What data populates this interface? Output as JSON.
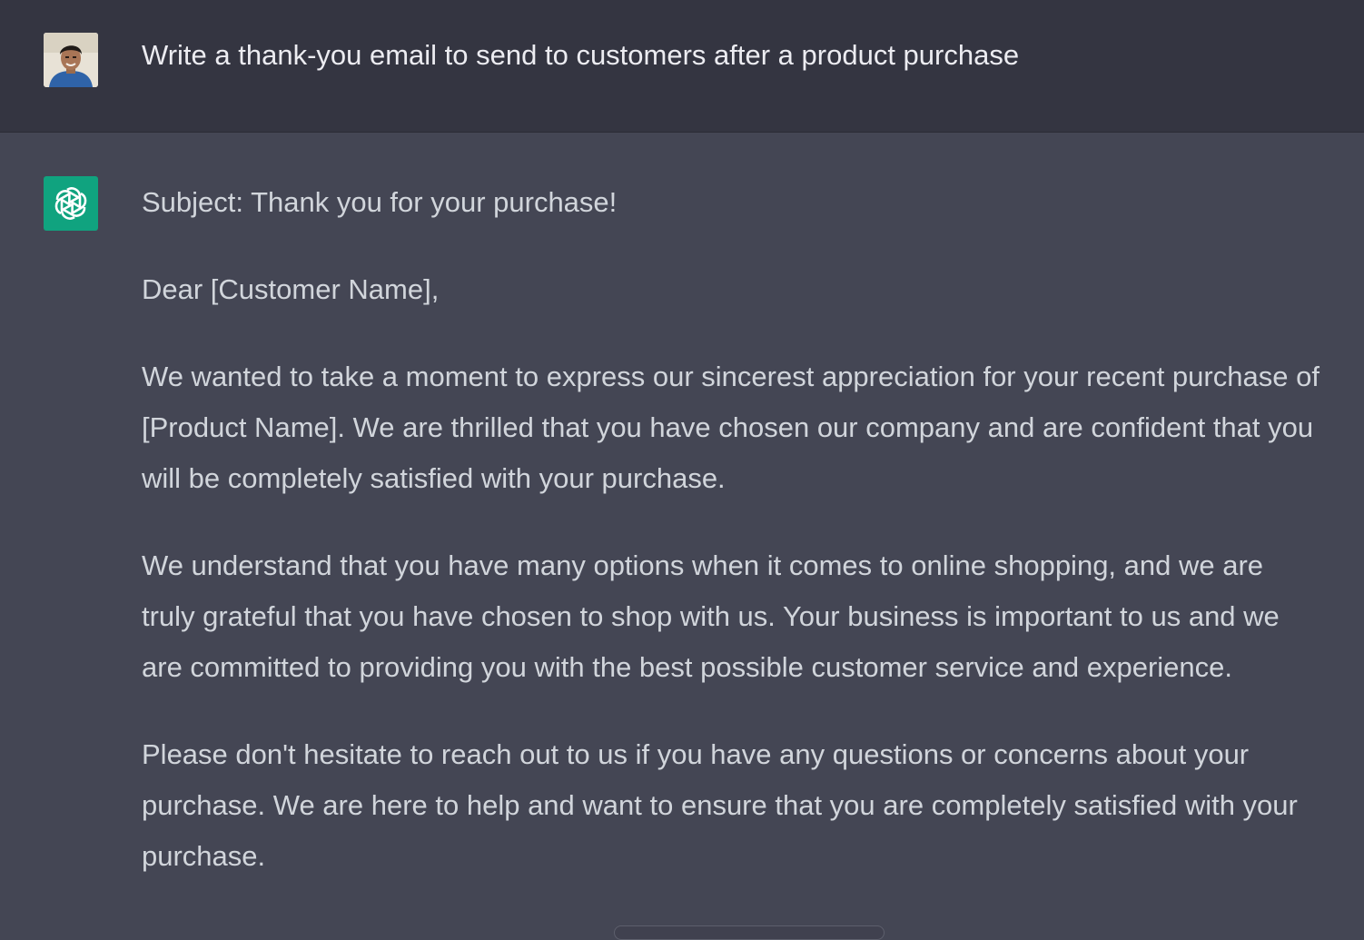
{
  "user_message": {
    "text": "Write a thank-you email to send to customers after a product purchase",
    "avatar_icon": "user-avatar-photo"
  },
  "assistant_message": {
    "avatar_icon": "openai-logo-icon",
    "paragraphs": [
      "Subject: Thank you for your purchase!",
      "Dear [Customer Name],",
      "We wanted to take a moment to express our sincerest appreciation for your recent purchase of [Product Name]. We are thrilled that you have chosen our company and are confident that you will be completely satisfied with your purchase.",
      "We understand that you have many options when it comes to online shopping, and we are truly grateful that you have chosen to shop with us. Your business is important to us and we are committed to providing you with the best possible customer service and experience.",
      "Please don't hesitate to reach out to us if you have any questions or concerns about your purchase. We are here to help and want to ensure that you are completely satisfied with your purchase."
    ]
  },
  "colors": {
    "user_bg": "#343541",
    "assistant_bg": "#444654",
    "brand_green": "#10a37f"
  }
}
